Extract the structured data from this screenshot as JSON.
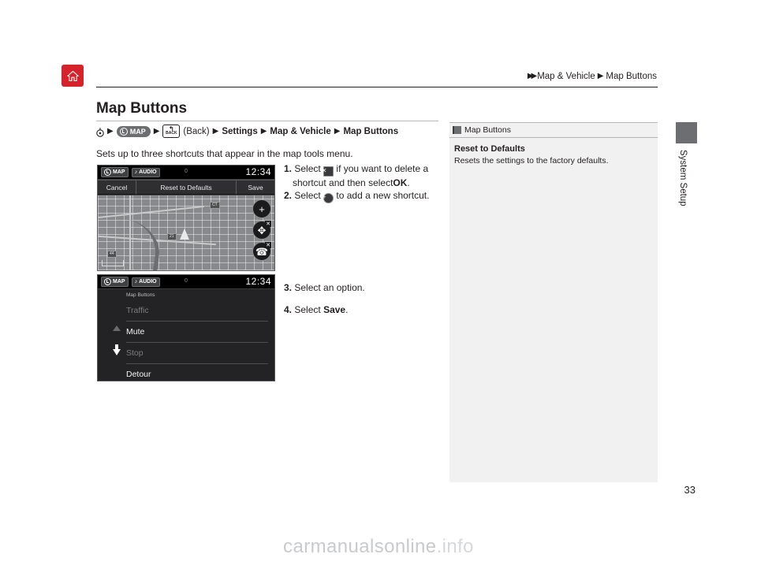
{
  "header": {
    "home_icon": "home-icon",
    "breadcrumb": [
      "Map & Vehicle",
      "Map Buttons"
    ]
  },
  "page": {
    "title": "Map Buttons",
    "page_number": "33"
  },
  "path": {
    "steering_icon": "steering-wheel-icon",
    "map_button_label": "MAP",
    "back_button_label": "BACK",
    "back_text": "(Back)",
    "items": [
      "Settings",
      "Map & Vehicle",
      "Map Buttons"
    ],
    "arrow": "▶"
  },
  "lead_text": "Sets up to three shortcuts that appear in the map tools menu.",
  "steps_group_1": [
    {
      "num": "1.",
      "pre": "Select",
      "icon": "delete-icon",
      "post": "if you want to delete a shortcut and then select",
      "bold_tail": "OK",
      "tail": "."
    },
    {
      "num": "2.",
      "pre": "Select",
      "icon": "add-icon",
      "post": "to add a new shortcut.",
      "bold_tail": "",
      "tail": ""
    }
  ],
  "steps_group_2": [
    {
      "num": "3.",
      "text": "Select an option.",
      "bold_tail": "",
      "tail": ""
    },
    {
      "num": "4.",
      "pre": "Select",
      "bold_tail": "Save",
      "tail": "."
    }
  ],
  "screenshot_1": {
    "name": "map-edit-screen",
    "status": {
      "map_tag": "MAP",
      "audio_tag": "AUDIO",
      "audio_icon": "music-note-icon",
      "center_value": "0",
      "clock": "12:34"
    },
    "toolbar": {
      "cancel": "Cancel",
      "reset": "Reset to Defaults",
      "save": "Save"
    },
    "map_badges": [
      "44",
      "CT",
      "21"
    ],
    "side_buttons": [
      {
        "name": "zoom-in-button",
        "glyph": "+",
        "has_x": false
      },
      {
        "name": "shortcut-slot-2",
        "glyph": "✥",
        "has_x": true
      },
      {
        "name": "shortcut-slot-3",
        "glyph": "☎",
        "has_x": true
      }
    ]
  },
  "screenshot_2": {
    "name": "map-buttons-list-screen",
    "status": {
      "map_tag": "MAP",
      "audio_tag": "AUDIO",
      "audio_icon": "music-note-icon",
      "center_value": "0",
      "clock": "12:34"
    },
    "list_title": "Map Buttons",
    "items": [
      {
        "label": "Traffic",
        "state": "dim"
      },
      {
        "label": "Mute",
        "state": "enabled"
      },
      {
        "label": "Stop",
        "state": "dim"
      },
      {
        "label": "Detour",
        "state": "enabled"
      }
    ],
    "scroll_up_icon": "scroll-up-arrow-icon",
    "scroll_down_icon": "scroll-down-arrow-icon"
  },
  "side_panel": {
    "icon": "book-icon",
    "header": "Map Buttons",
    "title": "Reset to Defaults",
    "text": "Resets the settings to the factory defaults."
  },
  "side_tab": {
    "label": "System Setup"
  },
  "watermark": {
    "text_main": "carmanualsonline",
    "text_dim": ".info"
  },
  "colors": {
    "accent_red": "#d6222a",
    "panel_bg": "#f1f1f2",
    "tab_gray": "#6d6e71"
  }
}
